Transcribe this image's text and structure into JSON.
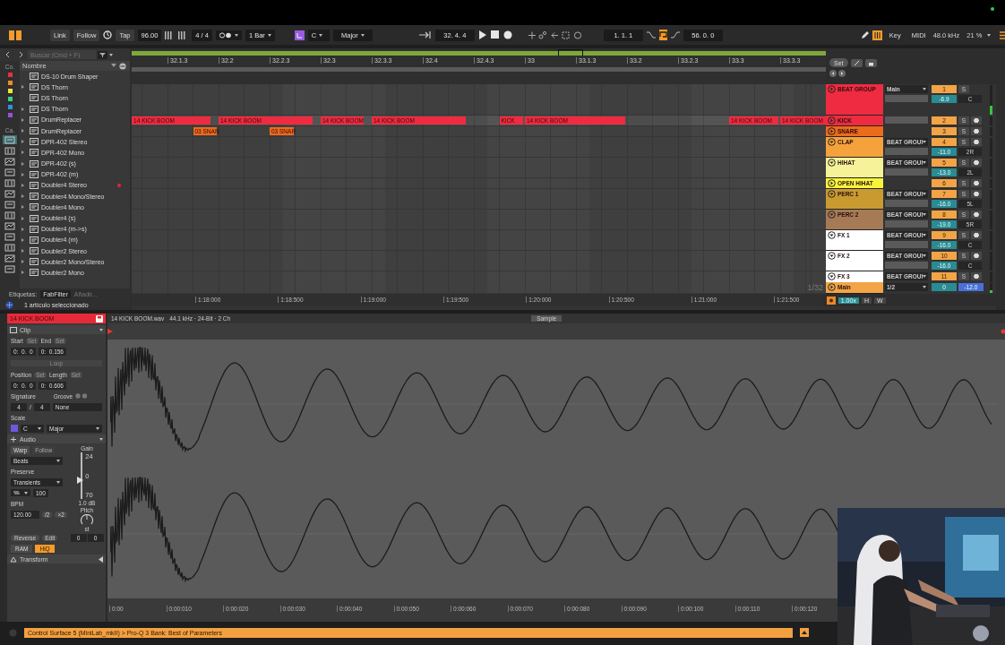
{
  "toolbar": {
    "link": "Link",
    "follow": "Follow",
    "tap": "Tap",
    "tempo": "96.00",
    "signature": "4 / 4",
    "quantization": "1 Bar",
    "key": "C",
    "scale": "Major",
    "position": "32. 4. 4",
    "loop_start": "1. 1. 1",
    "loop_on": true,
    "loop_length": "56. 0. 0",
    "key_map": "Key",
    "midi_map": "MIDI",
    "sample_rate": "48.0 kHz",
    "cpu": "21 %"
  },
  "browser": {
    "search_placeholder": "Buscar (Cmd + F)",
    "collections_label": "Co.",
    "collections": [
      {
        "color": "#e5323c"
      },
      {
        "color": "#f08a2c"
      },
      {
        "color": "#e8e83a"
      },
      {
        "color": "#3ad08a"
      },
      {
        "color": "#2f8fe0"
      },
      {
        "color": "#9a4fe0"
      }
    ],
    "categories_label": "Ca.",
    "categories": [
      {
        "selected": true
      },
      {
        "selected": false
      },
      {
        "selected": false
      },
      {
        "selected": false
      },
      {
        "selected": false
      },
      {
        "selected": false
      },
      {
        "selected": false
      },
      {
        "selected": false
      },
      {
        "selected": false
      },
      {
        "selected": false
      },
      {
        "selected": false
      },
      {
        "selected": false
      },
      {
        "selected": false
      }
    ],
    "column": "Nombre",
    "items": [
      {
        "name": "DS-10 Drum Shaper",
        "expandable": false,
        "marked": false
      },
      {
        "name": "DS Thorn",
        "expandable": true,
        "marked": false
      },
      {
        "name": "DS Thorn",
        "expandable": false,
        "marked": false
      },
      {
        "name": "DS Thorn",
        "expandable": true,
        "marked": false
      },
      {
        "name": "DrumReplacer",
        "expandable": true,
        "marked": false
      },
      {
        "name": "DrumReplacer",
        "expandable": true,
        "marked": false
      },
      {
        "name": "DPR-402 Stereo",
        "expandable": true,
        "marked": false
      },
      {
        "name": "DPR-402 Mono",
        "expandable": true,
        "marked": false
      },
      {
        "name": "DPR-402 (s)",
        "expandable": true,
        "marked": false
      },
      {
        "name": "DPR-402 (m)",
        "expandable": true,
        "marked": false
      },
      {
        "name": "Doubler4 Stereo",
        "expandable": true,
        "marked": true
      },
      {
        "name": "Doubler4 Mono/Stereo",
        "expandable": true,
        "marked": false
      },
      {
        "name": "Doubler4 Mono",
        "expandable": true,
        "marked": false
      },
      {
        "name": "Doubler4 (s)",
        "expandable": true,
        "marked": false
      },
      {
        "name": "Doubler4 (m->s)",
        "expandable": true,
        "marked": false
      },
      {
        "name": "Doubler4 (m)",
        "expandable": true,
        "marked": false
      },
      {
        "name": "Doubler2 Stereo",
        "expandable": true,
        "marked": false
      },
      {
        "name": "Doubler2 Mono/Stereo",
        "expandable": true,
        "marked": false
      },
      {
        "name": "Doubler2 Mono",
        "expandable": true,
        "marked": false
      }
    ],
    "tags_label": "Etiquetas:",
    "tag": "FabFilter",
    "add_tag": "Añadir...",
    "status": "1 artículo seleccionado"
  },
  "arrangement": {
    "ruler": [
      "32.1.3",
      "32.2",
      "32.2.3",
      "32.3",
      "32.3.3",
      "32.4",
      "32.4.3",
      "33",
      "33.1.3",
      "33.2",
      "33.2.3",
      "33.3",
      "33.3.3"
    ],
    "grid": "1/32",
    "time_ruler": [
      "1:18:000",
      "1:18:500",
      "1:19:000",
      "1:19:500",
      "1:20:000",
      "1:20:500",
      "1:21:000",
      "1:21:500"
    ]
  },
  "tracks_header": {
    "set": "Set"
  },
  "tracks": [
    {
      "name": "BEAT GROUP",
      "kind": "group",
      "color": "#ef2b41",
      "expanded": false,
      "selected": false,
      "output": "Main",
      "io_field": true,
      "number": "1",
      "solo": "S",
      "armable": false,
      "volume": "-6.9",
      "pan": "C"
    },
    {
      "name": "KICK",
      "kind": "audio",
      "color": "#ef2b41",
      "expanded": false,
      "selected": true,
      "io_field": true,
      "number": "2",
      "solo": "S",
      "armable": true,
      "clips": [
        {
          "name": "14 KICK BOOM"
        },
        {
          "name": "14 KICK BOOM"
        },
        {
          "name": "14 KICK BOOM"
        },
        {
          "name": "14 KICK BOOM"
        },
        {
          "name": "KICK"
        },
        {
          "name": "14 KICK BOOM"
        },
        {
          "name": "14 KICK BOOM"
        },
        {
          "name": "14 KICK BOOM"
        }
      ]
    },
    {
      "name": "SNARE",
      "kind": "audio",
      "color": "#ec6a1c",
      "expanded": false,
      "selected": false,
      "io_field": false,
      "number": "3",
      "solo": "S",
      "armable": true,
      "clips": [
        {
          "name": "03 SNAR"
        },
        {
          "name": "03 SNAR"
        }
      ]
    },
    {
      "name": "CLAP",
      "kind": "audio",
      "color": "#f5a23c",
      "expanded": true,
      "selected": false,
      "output": "BEAT GROUI",
      "io_field": true,
      "number": "4",
      "solo": "S",
      "armable": true,
      "volume": "-11.0",
      "pan": "2R"
    },
    {
      "name": "HIHAT",
      "kind": "audio",
      "color": "#f6f29a",
      "expanded": true,
      "selected": false,
      "output": "BEAT GROUI",
      "io_field": true,
      "number": "5",
      "solo": "S",
      "armable": true,
      "volume": "-13.0",
      "pan": "2L"
    },
    {
      "name": "OPEN HIHAT",
      "kind": "audio",
      "color": "#f8f43c",
      "expanded": false,
      "selected": false,
      "io_field": false,
      "number": "6",
      "solo": "S",
      "armable": true
    },
    {
      "name": "PERC 1",
      "kind": "audio",
      "color": "#c89a30",
      "expanded": true,
      "selected": false,
      "output": "BEAT GROUI",
      "io_field": true,
      "number": "7",
      "solo": "S",
      "armable": true,
      "volume": "-16.0",
      "pan": "5L"
    },
    {
      "name": "PERC 2",
      "kind": "audio",
      "color": "#a57a55",
      "expanded": true,
      "selected": false,
      "output": "BEAT GROUI",
      "io_field": true,
      "number": "8",
      "solo": "S",
      "armable": true,
      "volume": "-19.0",
      "pan": "5R"
    },
    {
      "name": "FX 1",
      "kind": "audio",
      "color": "#ffffff",
      "expanded": true,
      "selected": false,
      "output": "BEAT GROUI",
      "io_field": true,
      "number": "9",
      "solo": "S",
      "armable": true,
      "volume": "-16.0",
      "pan": "C"
    },
    {
      "name": "FX 2",
      "kind": "audio",
      "color": "#ffffff",
      "expanded": true,
      "selected": false,
      "output": "BEAT GROUI",
      "io_field": true,
      "number": "10",
      "solo": "S",
      "armable": true,
      "volume": "-16.0",
      "pan": "C"
    },
    {
      "name": "FX 3",
      "kind": "audio",
      "color": "#ffffff",
      "expanded": true,
      "selected": false,
      "output": "BEAT GROUI",
      "io_field": false,
      "number": "11",
      "solo": "S",
      "armable": true
    },
    {
      "name": "Main",
      "kind": "main",
      "color": "#f2a447",
      "expanded": false,
      "selected": false,
      "output": "1/2",
      "io_field": false,
      "armable": false,
      "cue": "0",
      "volume": "-12.0"
    }
  ],
  "zoom": {
    "value": "1.00x",
    "h": "H",
    "w": "W"
  },
  "clip_panel": {
    "title": "14 KICK BOOM",
    "section": "Clip",
    "start_label": "Start",
    "start_set": "Set",
    "end_label": "End",
    "end_set": "Set",
    "start": "0:  0.  0",
    "end": "0:  0.156",
    "loop": "Loop",
    "position_label": "Position",
    "position_set": "Set",
    "length_label": "Length",
    "length_set": "Set",
    "position": "0:  0.  0",
    "length": "0:  0.606",
    "signature_label": "Signature",
    "groove_label": "Groove",
    "sig_num": "4",
    "sig_sep": "/",
    "sig_den": "4",
    "groove": "None",
    "scale_label": "Scale",
    "key": "C",
    "scale": "Major"
  },
  "audio_panel": {
    "section": "Audio",
    "warp": "Warp",
    "follow": {
      "label": "Follow",
      "disabled": true
    },
    "warp_mode": "Beats",
    "preserve_label": "Preserve",
    "preserve": "Transients",
    "grain": "100",
    "bpm_label": "BPM",
    "bpm": "120.00",
    "half": "/2",
    "double": "×2",
    "gain_label": "Gain",
    "gain_max": "24",
    "gain_mid": "0",
    "gain_min": "70",
    "gain_level": {
      "level": 0.4
    },
    "gain": "1.0 dB",
    "pitch_label": "Pitch",
    "pitch_unit": "st",
    "reverse": "Reverse",
    "edit": "Edit",
    "ram": {
      "label": "RAM",
      "on": false
    },
    "hiq": {
      "label": "HiQ",
      "on": true
    },
    "transpose": "0",
    "detune": "0",
    "transform": "Transform"
  },
  "sample": {
    "file": "14 KICK BOOM.wav",
    "info": "44.1 kHz · 24-Bit · 2 Ch",
    "tab": "Sample",
    "ruler": [
      "0:00",
      "0:00:010",
      "0:00:020",
      "0:00:030",
      "0:00:040",
      "0:00:050",
      "0:00:060",
      "0:00:070",
      "0:00:080",
      "0:00:090",
      "0:00:100",
      "0:00:110",
      "0:00:120"
    ]
  },
  "status_bar": {
    "message": "Control Surface 5 (MiniLab_mkII) > Pro-Q 3 Bank: Best of Parameters"
  }
}
